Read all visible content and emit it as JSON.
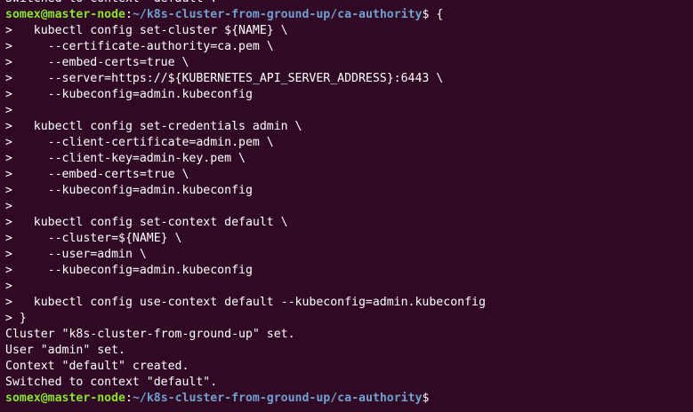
{
  "terminal": {
    "lines": [
      {
        "type": "output",
        "text": "Switched to context \"default\"."
      },
      {
        "type": "prompt",
        "user": "somex@master-node",
        "sep": ":",
        "path": "~/k8s-cluster-from-ground-up/ca-authority",
        "symbol": "$ ",
        "command": "{"
      },
      {
        "type": "output",
        "text": ">   kubectl config set-cluster ${NAME} \\"
      },
      {
        "type": "output",
        "text": ">     --certificate-authority=ca.pem \\"
      },
      {
        "type": "output",
        "text": ">     --embed-certs=true \\"
      },
      {
        "type": "output",
        "text": ">     --server=https://${KUBERNETES_API_SERVER_ADDRESS}:6443 \\"
      },
      {
        "type": "output",
        "text": ">     --kubeconfig=admin.kubeconfig"
      },
      {
        "type": "output",
        "text": ">"
      },
      {
        "type": "output",
        "text": ">   kubectl config set-credentials admin \\"
      },
      {
        "type": "output",
        "text": ">     --client-certificate=admin.pem \\"
      },
      {
        "type": "output",
        "text": ">     --client-key=admin-key.pem \\"
      },
      {
        "type": "output",
        "text": ">     --embed-certs=true \\"
      },
      {
        "type": "output",
        "text": ">     --kubeconfig=admin.kubeconfig"
      },
      {
        "type": "output",
        "text": ">"
      },
      {
        "type": "output",
        "text": ">   kubectl config set-context default \\"
      },
      {
        "type": "output",
        "text": ">     --cluster=${NAME} \\"
      },
      {
        "type": "output",
        "text": ">     --user=admin \\"
      },
      {
        "type": "output",
        "text": ">     --kubeconfig=admin.kubeconfig"
      },
      {
        "type": "output",
        "text": ">"
      },
      {
        "type": "output",
        "text": ">   kubectl config use-context default --kubeconfig=admin.kubeconfig"
      },
      {
        "type": "output",
        "text": "> }"
      },
      {
        "type": "output",
        "text": "Cluster \"k8s-cluster-from-ground-up\" set."
      },
      {
        "type": "output",
        "text": "User \"admin\" set."
      },
      {
        "type": "output",
        "text": "Context \"default\" created."
      },
      {
        "type": "output",
        "text": "Switched to context \"default\"."
      },
      {
        "type": "prompt",
        "user": "somex@master-node",
        "sep": ":",
        "path": "~/k8s-cluster-from-ground-up/ca-authority",
        "symbol": "$",
        "command": ""
      }
    ]
  }
}
